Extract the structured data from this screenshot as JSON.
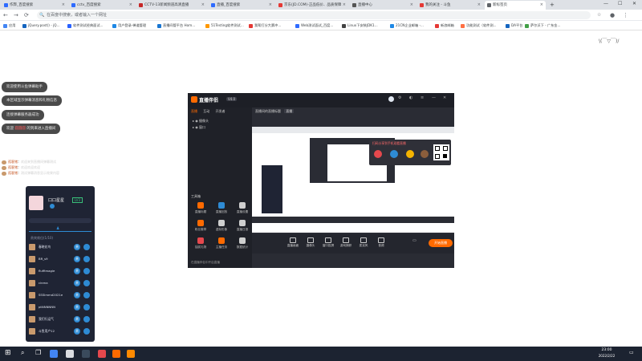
{
  "browser": {
    "tabs": [
      {
        "label": "作弊_百度搜索",
        "color": "#2f6bff"
      },
      {
        "label": "cctv_百度搜索",
        "color": "#2f6bff"
      },
      {
        "label": "CCTV-13新闻频道高清直播",
        "color": "#c62828"
      },
      {
        "label": "直播_百度搜索",
        "color": "#2f6bff"
      },
      {
        "label": "京东(JD.COM)-正品低价、品质保障",
        "color": "#e53935"
      },
      {
        "label": "直播中心",
        "color": "#555555"
      },
      {
        "label": "我的关注 - 斗鱼",
        "color": "#e53935"
      },
      {
        "label": "新标签页",
        "color": "#5f6368"
      }
    ],
    "new_tab": "+",
    "omnibox_placeholder": "在百度中搜索，或者输入一个网址",
    "bookmarks": [
      {
        "label": "应用",
        "color": "#4285f4"
      },
      {
        "label": "jQuery.post() - jQ...",
        "color": "#1565c0"
      },
      {
        "label": "软件测试经典面试...",
        "color": "#2962ff"
      },
      {
        "label": "用户登录-禅道管理",
        "color": "#1e88e5"
      },
      {
        "label": "直播间管平台 Hom...",
        "color": "#1976d2"
      },
      {
        "label": "51Testing软件测试...",
        "color": "#ff9800"
      },
      {
        "label": "我帮打分大赛冲...",
        "color": "#e53935"
      },
      {
        "label": "Web测试面试_百度...",
        "color": "#2f6bff"
      },
      {
        "label": "Linux下安装JDK1...",
        "color": "#424242"
      },
      {
        "label": "21CN企业邮箱 -...",
        "color": "#1e88e5"
      },
      {
        "label": "新浪邮箱",
        "color": "#e53935"
      },
      {
        "label": "功能测试（软件测...",
        "color": "#ff7043"
      },
      {
        "label": "DA平台",
        "color": "#1565c0"
      },
      {
        "label": "萨尔沃下 - 广东金...",
        "color": "#43a047"
      }
    ]
  },
  "corner_badge": "\\(￣▽￣)/",
  "notifications": [
    {
      "text": "欢迎使用斗鱼弹幕助手"
    },
    {
      "text": "本区域显示弹幕消息和礼物信息"
    },
    {
      "text": "连接弹幕服务器成功"
    },
    {
      "pre": "欢迎 ",
      "name": "圆圆圆",
      "post": " 的到来进入直播间"
    }
  ],
  "chat": [
    {
      "name": "孤客猪",
      "msg": "欢迎来到直播间弹幕测试"
    },
    {
      "name": "孤客猪",
      "msg": "欢迎欢迎欢迎"
    },
    {
      "name": "孤客猪",
      "msg": "测试弹幕消息显示效果内容"
    }
  ],
  "left_panel": {
    "username": "口口星星",
    "level": "LV3",
    "section_title": "贵宾席位(1/10)",
    "users": [
      {
        "name": "春晓花鸟",
        "badge": "贵"
      },
      {
        "name": "BR_s9",
        "badge": "贵"
      },
      {
        "name": "fluffimagie",
        "badge": "贵"
      },
      {
        "name": "cinma",
        "badge": "贵"
      },
      {
        "name": "SSSImmd2021e",
        "badge": "贵"
      },
      {
        "name": "ptNNNNNN",
        "badge": "贵"
      },
      {
        "name": "我们行运气",
        "badge": "贵"
      },
      {
        "name": "斗鱼用户12",
        "badge": "贵"
      }
    ]
  },
  "app": {
    "logo": "直播伴侣",
    "version": "V4.0",
    "top_tabs": [
      "直播",
      "互动",
      "开发者"
    ],
    "room_title": "直播间的直播标题",
    "room_badge": "直播",
    "scene_items": [
      "摄像头",
      "窗口"
    ],
    "tools_title": "工具箱",
    "tools": [
      {
        "label": "直播标题"
      },
      {
        "label": "直播回放"
      },
      {
        "label": "直播设置"
      },
      {
        "label": "粉丝徽章"
      },
      {
        "label": "虚拟形象"
      },
      {
        "label": "直播日报"
      },
      {
        "label": "抽奖礼物"
      },
      {
        "label": "主播任务"
      },
      {
        "label": "数据统计"
      }
    ],
    "side_footer": "在直播伴侣中开启直播",
    "bottom_tools": [
      {
        "label": "直播画面"
      },
      {
        "label": "摄像头"
      },
      {
        "label": "窗口投屏"
      },
      {
        "label": "游戏捕获"
      },
      {
        "label": "麦克风"
      },
      {
        "label": "音频"
      }
    ],
    "start_button": "开始直播",
    "popup_title": "扫码分享到手机观看直播"
  },
  "taskbar": {
    "time": "23:00",
    "date": "2022/2/22"
  },
  "colors": {
    "accent_orange": "#ff6a00",
    "accent_red": "#e5484d",
    "panel_dark": "#1f2434",
    "app_dark": "#24262e"
  }
}
